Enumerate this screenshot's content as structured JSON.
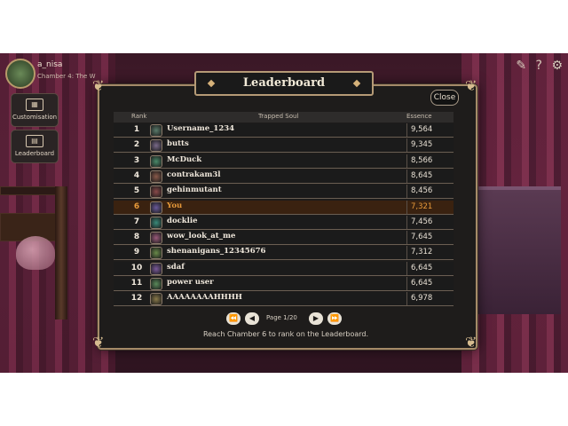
{
  "user": {
    "name": "a_nisa",
    "subtitle": "Chamber 4: The W"
  },
  "sidebar": [
    {
      "label": "Customisation",
      "icon": "wardrobe-icon"
    },
    {
      "label": "Leaderboard",
      "icon": "leaderboard-icon"
    }
  ],
  "topbar": {
    "icons": [
      "edit-icon",
      "help-icon",
      "gear-icon"
    ]
  },
  "leaderboard": {
    "title": "Leaderboard",
    "close_label": "Close",
    "columns": {
      "rank": "Rank",
      "name": "Trapped Soul",
      "score": "Essence"
    },
    "rows": [
      {
        "rank": "1",
        "name": "Username_1234",
        "score": "9,564",
        "color": "#5a7a6a"
      },
      {
        "rank": "2",
        "name": "butts",
        "score": "9,345",
        "color": "#7a6a8a"
      },
      {
        "rank": "3",
        "name": "McDuck",
        "score": "8,566",
        "color": "#4a8a6a"
      },
      {
        "rank": "4",
        "name": "contrakam3l",
        "score": "8,645",
        "color": "#8a5a4a"
      },
      {
        "rank": "5",
        "name": "gehinmutant",
        "score": "8,456",
        "color": "#8a4a4a"
      },
      {
        "rank": "6",
        "name": "You",
        "score": "7,321",
        "color": "#6a5a9a",
        "highlight": true
      },
      {
        "rank": "7",
        "name": "docklie",
        "score": "7,456",
        "color": "#3a8a7a"
      },
      {
        "rank": "8",
        "name": "wow_look_at_me",
        "score": "7,645",
        "color": "#9a5a7a"
      },
      {
        "rank": "9",
        "name": "shenanigans_12345676",
        "score": "7,312",
        "color": "#6a8a4a"
      },
      {
        "rank": "10",
        "name": "sdaf",
        "score": "6,645",
        "color": "#7a5a9a"
      },
      {
        "rank": "11",
        "name": "power user",
        "score": "6,645",
        "color": "#5a8a5a"
      },
      {
        "rank": "12",
        "name": "AAAAAAAAHHHH",
        "score": "6,978",
        "color": "#8a7a4a"
      }
    ],
    "page_label": "Page 1/20",
    "footer": "Reach Chamber 6 to rank on the Leaderboard."
  }
}
